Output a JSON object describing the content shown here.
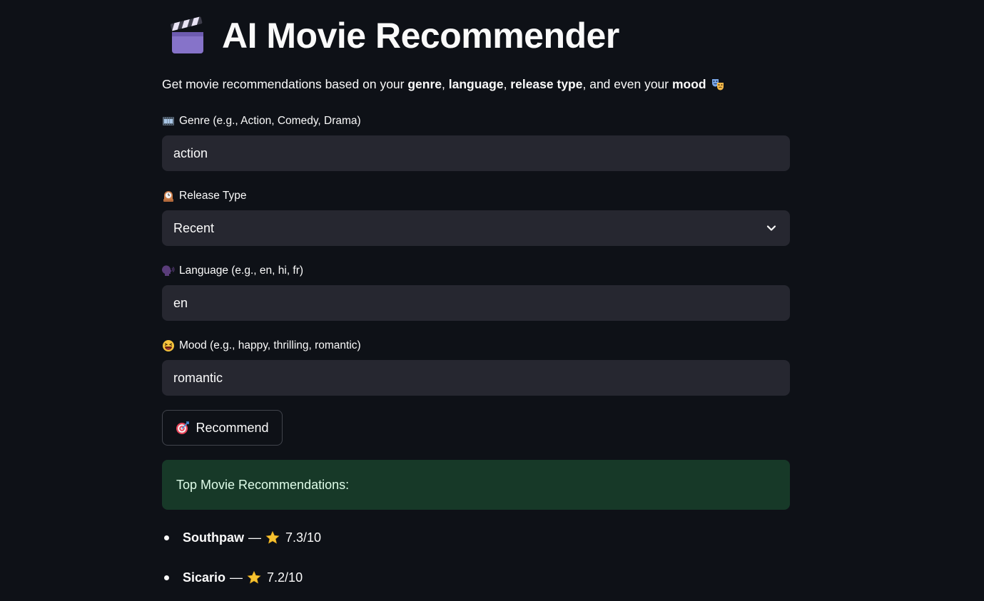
{
  "header": {
    "title": "AI Movie Recommender",
    "title_icon": "clapper-board-icon"
  },
  "subtitle": {
    "prefix": "Get movie recommendations based on your ",
    "genre": "genre",
    "comma1": ", ",
    "language": "language",
    "comma2": ", ",
    "release_type": "release type",
    "middle": ", and even your ",
    "mood": "mood",
    "icon": "performing-arts-icon"
  },
  "form": {
    "genre": {
      "label": "Genre (e.g., Action, Comedy, Drama)",
      "icon": "film-frames-icon",
      "value": "action"
    },
    "release_type": {
      "label": "Release Type",
      "icon": "mantelpiece-clock-icon",
      "value": "Recent"
    },
    "language": {
      "label": "Language (e.g., en, hi, fr)",
      "icon": "speaking-head-icon",
      "value": "en"
    },
    "mood": {
      "label": "Mood (e.g., happy, thrilling, romantic)",
      "icon": "grinning-squinting-face-icon",
      "value": "romantic"
    },
    "recommend_button": {
      "label": "Recommend",
      "icon": "direct-hit-icon"
    }
  },
  "results": {
    "heading": "Top Movie Recommendations:",
    "items": [
      {
        "title": "Southpaw",
        "separator": "—",
        "rating": "7.3/10"
      },
      {
        "title": "Sicario",
        "separator": "—",
        "rating": "7.2/10"
      }
    ]
  },
  "colors": {
    "background": "#0e1117",
    "input_bg": "#262730",
    "success_bg": "#173928",
    "success_text": "#dffde9",
    "text": "#fafafa"
  }
}
